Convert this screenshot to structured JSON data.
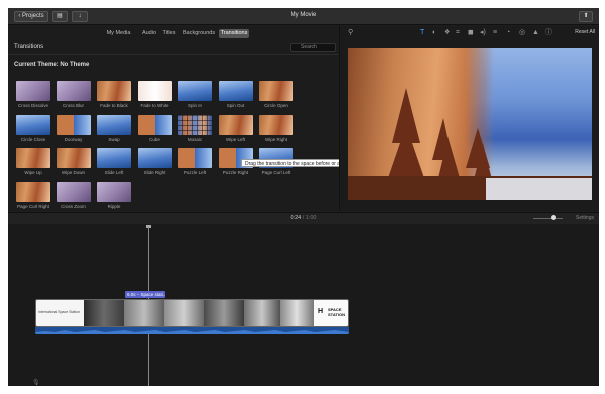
{
  "colors": {
    "app_bg": "#1e1e1e",
    "accent_clip_label": "#5962c9",
    "audio_track": "#1f4f96",
    "selected_tab": "#555555"
  },
  "titlebar": {
    "projects_button": "‹ Projects",
    "library_button": "▤",
    "media_button": "↓",
    "window_title": "My Movie",
    "share_button": "⬆"
  },
  "media_tabs": [
    "My Media",
    "Audio",
    "Titles",
    "Backgrounds",
    "Transitions"
  ],
  "active_tab": "Transitions",
  "browser": {
    "section_title": "Transitions",
    "search_placeholder": "Search",
    "theme_label": "Current Theme: No Theme",
    "transitions": [
      {
        "label": "Cross Dissolve",
        "style": "lav"
      },
      {
        "label": "Cross Blur",
        "style": "lav"
      },
      {
        "label": "Fade to Black",
        "style": "cliff"
      },
      {
        "label": "Fade to White",
        "style": "white"
      },
      {
        "label": "Spin In",
        "style": "blue"
      },
      {
        "label": "Spin Out",
        "style": "blue"
      },
      {
        "label": "Circle Open",
        "style": "cliff"
      },
      {
        "label": "Circle Close",
        "style": "blue"
      },
      {
        "label": "Doorway",
        "style": "mixed"
      },
      {
        "label": "Swap",
        "style": "blue"
      },
      {
        "label": "Cube",
        "style": "mixed"
      },
      {
        "label": "Mosaic",
        "style": "mosaic"
      },
      {
        "label": "Wipe Left",
        "style": "cliff"
      },
      {
        "label": "Wipe Right",
        "style": "cliff"
      },
      {
        "label": "Wipe Up",
        "style": "cliff"
      },
      {
        "label": "Wipe Down",
        "style": "cliff"
      },
      {
        "label": "Slide Left",
        "style": "blue"
      },
      {
        "label": "Slide Right",
        "style": "blue"
      },
      {
        "label": "Puzzle Left",
        "style": "mixed"
      },
      {
        "label": "Puzzle Right",
        "style": "mixed"
      },
      {
        "label": "Page Curl Left",
        "style": "blue"
      },
      {
        "label": "Page Curl Right",
        "style": "cliff"
      },
      {
        "label": "Cross Zoom",
        "style": "lav"
      },
      {
        "label": "Ripple",
        "style": "lav"
      }
    ],
    "tooltip": "Drag the transition to the space before or after a clip"
  },
  "viewer": {
    "tool_icons": [
      "wand-icon",
      "title-T-icon",
      "color-balance-icon",
      "palette-icon",
      "crop-icon",
      "camera-icon",
      "volume-icon",
      "equalizer-icon",
      "speed-icon",
      "stabilize-icon",
      "filter-icon",
      "info-icon"
    ],
    "reset_all": "Reset All"
  },
  "timeline": {
    "timecode_current": "0:24",
    "timecode_total": "/ 1:00",
    "settings_label": "Settings",
    "clip_label": "6.0s – Space stati...",
    "title_card_text": "International Space Station",
    "space_card_logo": "H",
    "space_card_text": "SPACE STATION",
    "zoom_level": 0.67
  }
}
